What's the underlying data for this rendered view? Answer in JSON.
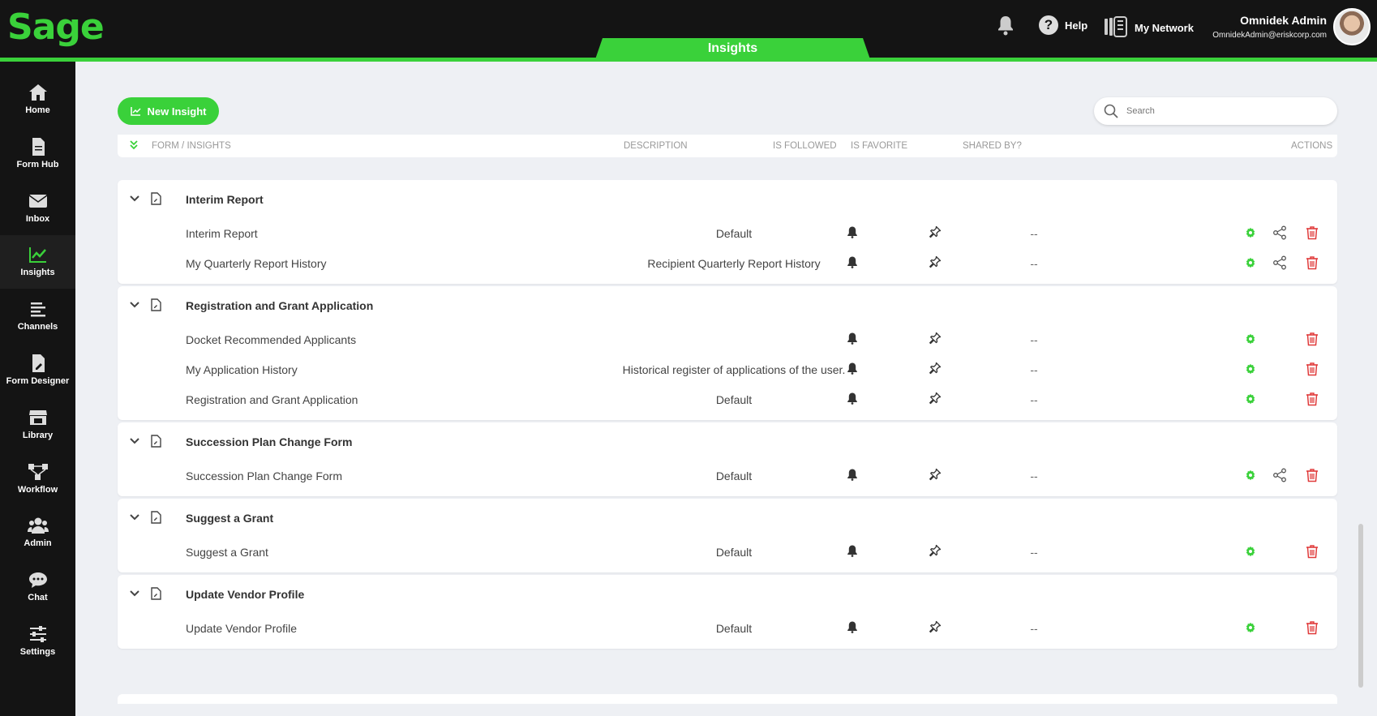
{
  "brand": {
    "logo": "Sage",
    "accent": "#3ad13a",
    "topbar_bg": "#141414"
  },
  "top_tab": {
    "label": "Insights"
  },
  "header": {
    "help_label": "Help",
    "network_label": "My Network",
    "user_name": "Omnidek Admin",
    "user_email": "OmnidekAdmin@eriskcorp.com"
  },
  "sidebar": {
    "items": [
      {
        "label": "Home",
        "icon": "home-icon"
      },
      {
        "label": "Form Hub",
        "icon": "document-icon"
      },
      {
        "label": "Inbox",
        "icon": "envelope-icon"
      },
      {
        "label": "Insights",
        "icon": "chart-icon",
        "active": true
      },
      {
        "label": "Channels",
        "icon": "lines-icon"
      },
      {
        "label": "Form Designer",
        "icon": "document-edit-icon"
      },
      {
        "label": "Library",
        "icon": "store-icon"
      },
      {
        "label": "Workflow",
        "icon": "workflow-icon"
      },
      {
        "label": "Admin",
        "icon": "users-icon"
      },
      {
        "label": "Chat",
        "icon": "chat-icon"
      },
      {
        "label": "Settings",
        "icon": "sliders-icon"
      }
    ]
  },
  "toolbar": {
    "new_insight_label": "New Insight",
    "search_placeholder": "Search"
  },
  "table_header": {
    "col_form": "FORM / INSIGHTS",
    "col_description": "DESCRIPTION",
    "col_followed": "IS FOLLOWED",
    "col_favorite": "IS FAVORITE",
    "col_shared": "SHARED BY?",
    "col_actions": "ACTIONS"
  },
  "groups": [
    {
      "title": "Interim Report",
      "rows": [
        {
          "name": "Interim Report",
          "description": "Default",
          "shared": "--",
          "shareable": true
        },
        {
          "name": "My Quarterly Report History",
          "description": "Recipient Quarterly Report History",
          "shared": "--",
          "shareable": true
        }
      ]
    },
    {
      "title": "Registration and Grant Application",
      "rows": [
        {
          "name": "Docket Recommended Applicants",
          "description": "",
          "shared": "--",
          "shareable": false
        },
        {
          "name": "My Application History",
          "description": "Historical register of applications of the user.",
          "shared": "--",
          "shareable": false
        },
        {
          "name": "Registration and Grant Application",
          "description": "Default",
          "shared": "--",
          "shareable": false
        }
      ]
    },
    {
      "title": "Succession Plan Change Form",
      "rows": [
        {
          "name": "Succession Plan Change Form",
          "description": "Default",
          "shared": "--",
          "shareable": true
        }
      ]
    },
    {
      "title": "Suggest a Grant",
      "rows": [
        {
          "name": "Suggest a Grant",
          "description": "Default",
          "shared": "--",
          "shareable": false
        }
      ]
    },
    {
      "title": "Update Vendor Profile",
      "rows": [
        {
          "name": "Update Vendor Profile",
          "description": "Default",
          "shared": "--",
          "shareable": false
        }
      ]
    }
  ]
}
